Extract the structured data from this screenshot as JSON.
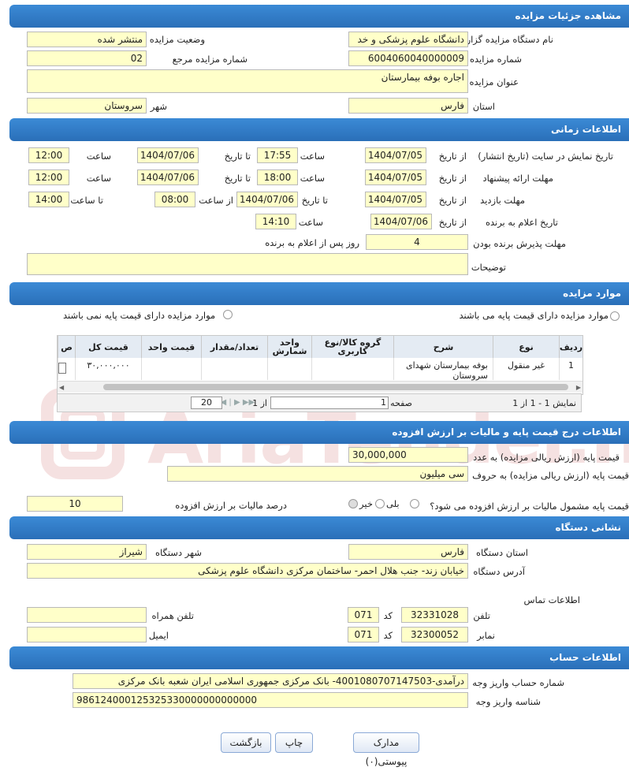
{
  "sections": {
    "details": "مشاهده جزئیات مزایده",
    "timing": "اطلاعات زمانی",
    "items": "موارد مزایده",
    "price": "اطلاعات درج قیمت پایه و مالیات بر ارزش افزوده",
    "address": "نشانی دستگاه",
    "account": "اطلاعات حساب"
  },
  "details": {
    "org_label": "نام دستگاه مزایده گزار",
    "org_value": "دانشگاه علوم پزشکی و خد",
    "status_label": "وضعیت مزایده",
    "status_value": "منتشر شده",
    "number_label": "شماره مزایده",
    "number_value": "6004060040000009",
    "ref_label": "شماره مزایده مرجع",
    "ref_value": "02",
    "title_label": "عنوان مزایده",
    "title_value": "اجاره بوفه بیمارستان",
    "province_label": "استان",
    "province_value": "فارس",
    "city_label": "شهر",
    "city_value": "سروستان"
  },
  "timing": {
    "publish_label": "تاریخ نمایش در سایت (تاریخ انتشار)",
    "bid_label": "مهلت ارائه پیشنهاد",
    "visit_label": "مهلت بازدید",
    "announce_label": "تاریخ اعلام به برنده",
    "accept_label": "مهلت پذیرش برنده بودن",
    "desc_label": "توضیحات",
    "from_date": "از تاریخ",
    "to_date": "تا تاریخ",
    "time": "ساعت",
    "from_time": "از ساعت",
    "to_time": "تا ساعت",
    "publish_from": "1404/07/05",
    "publish_time1": "17:55",
    "publish_to": "1404/07/06",
    "publish_time2": "12:00",
    "bid_from": "1404/07/05",
    "bid_time1": "18:00",
    "bid_to": "1404/07/06",
    "bid_time2": "12:00",
    "visit_from": "1404/07/05",
    "visit_to": "1404/07/06",
    "visit_from_time": "08:00",
    "visit_to_time": "14:00",
    "announce_date": "1404/07/06",
    "announce_time": "14:10",
    "accept_value": "4",
    "accept_unit": "روز پس از اعلام به برنده",
    "desc_value": ""
  },
  "items": {
    "radio_with_base": "موارد مزایده دارای قیمت پایه می باشند",
    "radio_without_base": "موارد مزایده دارای قیمت پایه نمی باشند",
    "headers": [
      "ردیف",
      "نوع",
      "شرح",
      "گروه کالا/نوع کاربری",
      "واحد شمارش",
      "تعداد/مقدار",
      "قیمت واحد",
      "قیمت کل",
      "ص"
    ],
    "rows": [
      [
        "1",
        "غیر منقول",
        "بوفه بیمارستان شهدای سروستان",
        "",
        "",
        "",
        "",
        "۳۰,۰۰۰,۰۰۰",
        ""
      ]
    ],
    "pager_summary": "نمایش 1 - 1 از 1",
    "page_label": "صفحه",
    "page_value": "1",
    "page_of": "از 1",
    "page_size": "20"
  },
  "price": {
    "base_label": "قیمت پایه (ارزش ریالی مزایده) به عدد",
    "base_value": "30,000,000",
    "words_label": "قیمت پایه (ارزش ریالی مزایده) به حروف",
    "words_value": "سی میلیون",
    "vat_question": "قیمت پایه مشمول مالیات بر ارزش افزوده می شود؟",
    "yes": "بلی",
    "no": "خیر",
    "vat_percent_label": "درصد مالیات بر ارزش افزوده",
    "vat_percent_value": "10"
  },
  "address": {
    "province_label": "استان دستگاه",
    "province_value": "فارس",
    "city_label": "شهر دستگاه",
    "city_value": "شیراز",
    "addr_label": "آدرس دستگاه",
    "addr_value": "خیابان زند- جنب هلال احمر- ساختمان مرکزی دانشگاه علوم پزشکی",
    "contact_label": "اطلاعات تماس",
    "phone_label": "تلفن",
    "phone_value": "32331028",
    "code_label": "کد",
    "phone_code": "071",
    "mobile_label": "تلفن همراه",
    "mobile_value": "",
    "fax_label": "نمابر",
    "fax_value": "32300052",
    "fax_code": "071",
    "email_label": "ایمیل",
    "email_value": ""
  },
  "account": {
    "acct_label": "شماره حساب واریز وجه",
    "acct_value": "درآمدی-4001080707147503- بانک مرکزی جمهوری اسلامی ایران شعبه بانک مرکزی",
    "id_label": "شناسه واریز وجه",
    "id_value": "986124000125325330000000000000"
  },
  "buttons": {
    "attachments": "مدارک پیوستی(۰)",
    "print": "چاپ",
    "back": "بازگشت"
  },
  "watermark": "AriaTender.net",
  "colors": {
    "header": "#2a6fb8",
    "field": "#ffffc9"
  }
}
